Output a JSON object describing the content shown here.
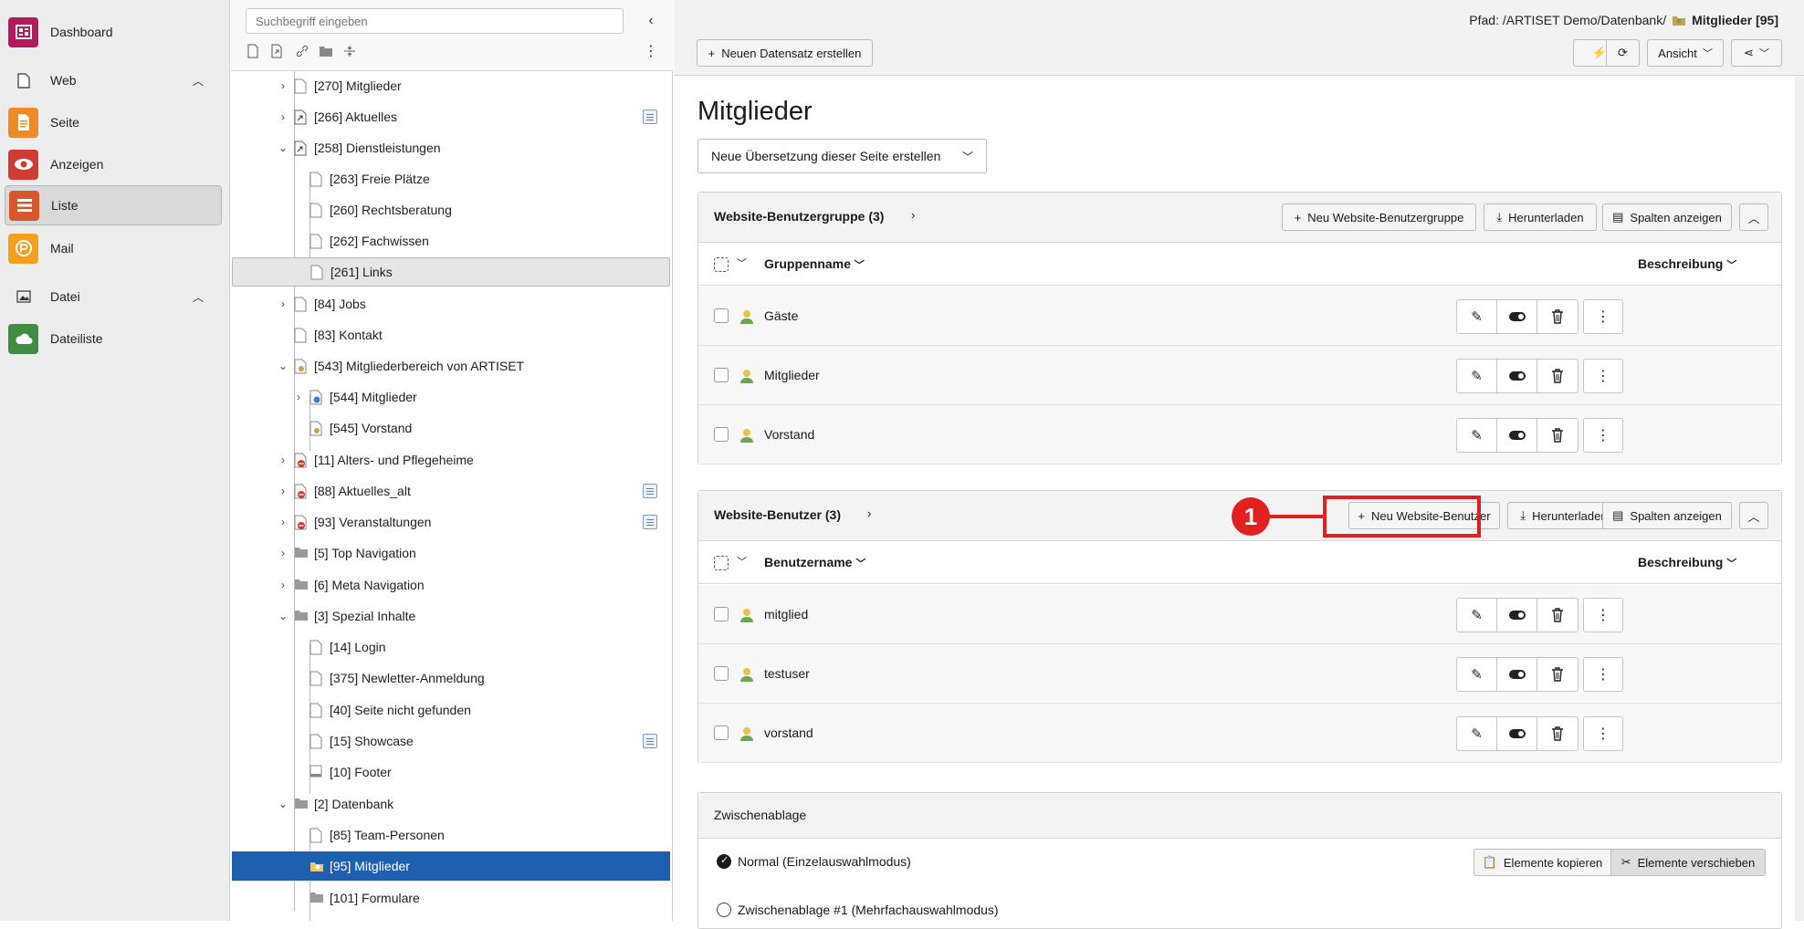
{
  "modules": {
    "dashboard": "Dashboard",
    "web": "Web",
    "seite": "Seite",
    "anzeigen": "Anzeigen",
    "liste": "Liste",
    "mail": "Mail",
    "datei": "Datei",
    "dateiliste": "Dateiliste"
  },
  "tree": {
    "search_placeholder": "Suchbegriff eingeben",
    "items": [
      {
        "label": "[270] Mitglieder"
      },
      {
        "label": "[266] Aktuelles"
      },
      {
        "label": "[258] Dienstleistungen"
      },
      {
        "label": "[263] Freie Plätze"
      },
      {
        "label": "[260] Rechtsberatung"
      },
      {
        "label": "[262] Fachwissen"
      },
      {
        "label": "[261] Links"
      },
      {
        "label": "[84] Jobs"
      },
      {
        "label": "[83] Kontakt"
      },
      {
        "label": "[543] Mitgliederbereich von ARTISET"
      },
      {
        "label": "[544] Mitglieder"
      },
      {
        "label": "[545] Vorstand"
      },
      {
        "label": "[11] Alters- und Pflegeheime"
      },
      {
        "label": "[88] Aktuelles_alt"
      },
      {
        "label": "[93] Veranstaltungen"
      },
      {
        "label": "[5] Top Navigation"
      },
      {
        "label": "[6] Meta Navigation"
      },
      {
        "label": "[3] Spezial Inhalte"
      },
      {
        "label": "[14] Login"
      },
      {
        "label": "[375] Newletter-Anmeldung"
      },
      {
        "label": "[40] Seite nicht gefunden"
      },
      {
        "label": "[15] Showcase"
      },
      {
        "label": "[10] Footer"
      },
      {
        "label": "[2] Datenbank"
      },
      {
        "label": "[85] Team-Personen"
      },
      {
        "label": "[95] Mitglieder"
      },
      {
        "label": "[101] Formulare"
      }
    ]
  },
  "header": {
    "path_prefix": "Pfad: /ARTISET Demo/Datenbank/",
    "path_current": "Mitglieder [95]",
    "new_record": "Neuen Datensatz erstellen",
    "view_label": "Ansicht"
  },
  "page": {
    "title": "Mitglieder",
    "translation_select": "Neue Übersetzung dieser Seite erstellen"
  },
  "groups_panel": {
    "title": "Website-Benutzergruppe (3)",
    "new_button": "Neu Website-Benutzergruppe",
    "download": "Herunterladen",
    "columns_button": "Spalten anzeigen",
    "col_name": "Gruppenname",
    "col_desc": "Beschreibung",
    "rows": [
      "Gäste",
      "Mitglieder",
      "Vorstand"
    ]
  },
  "users_panel": {
    "title": "Website-Benutzer (3)",
    "new_button": "Neu Website-Benutzer",
    "download": "Herunterladen",
    "columns_button": "Spalten anzeigen",
    "col_name": "Benutzername",
    "col_desc": "Beschreibung",
    "rows": [
      "mitglied",
      "testuser",
      "vorstand"
    ]
  },
  "annotation": {
    "badge": "1",
    "color": "#e32020"
  },
  "clipboard": {
    "title": "Zwischenablage",
    "mode_normal": "Normal (Einzelauswahlmodus)",
    "mode_multi": "Zwischenablage #1 (Mehrfachauswahlmodus)",
    "copy": "Elemente kopieren",
    "move": "Elemente verschieben"
  },
  "colors": {
    "dashboard": "#b31a5e",
    "seite": "#f08a24",
    "anzeigen": "#d13c32",
    "liste": "#d8572a",
    "mail": "#f3a11b",
    "dateiliste": "#3e8e41",
    "tree_selected": "#1f5fb0"
  }
}
